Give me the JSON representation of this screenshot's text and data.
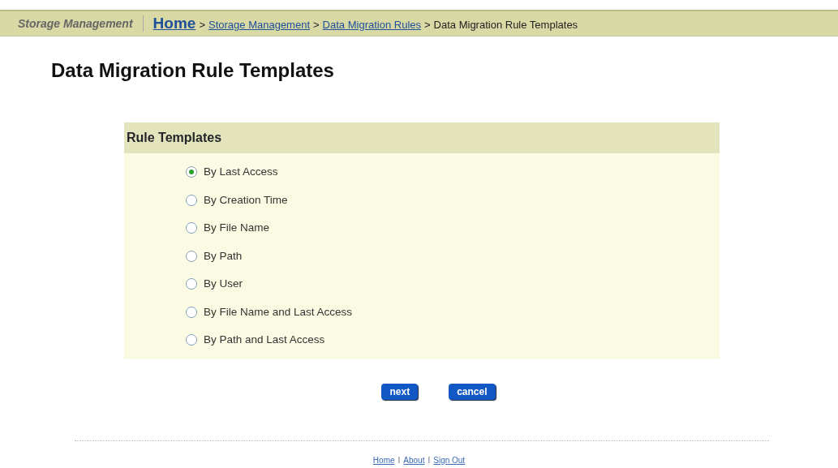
{
  "header": {
    "app_title": "Storage Management",
    "breadcrumb": [
      {
        "label": "Home",
        "kind": "home"
      },
      {
        "label": ">",
        "kind": "separator"
      },
      {
        "label": "Storage Management",
        "kind": "link"
      },
      {
        "label": ">",
        "kind": "separator"
      },
      {
        "label": "Data Migration Rules",
        "kind": "link"
      },
      {
        "label": ">",
        "kind": "separator"
      },
      {
        "label": "Data Migration Rule Templates",
        "kind": "current"
      }
    ]
  },
  "page_title": "Data Migration Rule Templates",
  "panel": {
    "title": "Rule Templates",
    "options": [
      {
        "label": "By Last Access",
        "selected": true
      },
      {
        "label": "By Creation Time",
        "selected": false
      },
      {
        "label": "By File Name",
        "selected": false
      },
      {
        "label": "By Path",
        "selected": false
      },
      {
        "label": "By User",
        "selected": false
      },
      {
        "label": "By File Name and Last Access",
        "selected": false
      },
      {
        "label": "By Path and Last Access",
        "selected": false
      }
    ]
  },
  "buttons": [
    "next",
    "cancel"
  ],
  "footer": [
    {
      "label": "Home",
      "kind": "link"
    },
    {
      "label": "I",
      "kind": "separator"
    },
    {
      "label": "About",
      "kind": "link"
    },
    {
      "label": "I",
      "kind": "separator"
    },
    {
      "label": "Sign Out",
      "kind": "link"
    }
  ]
}
